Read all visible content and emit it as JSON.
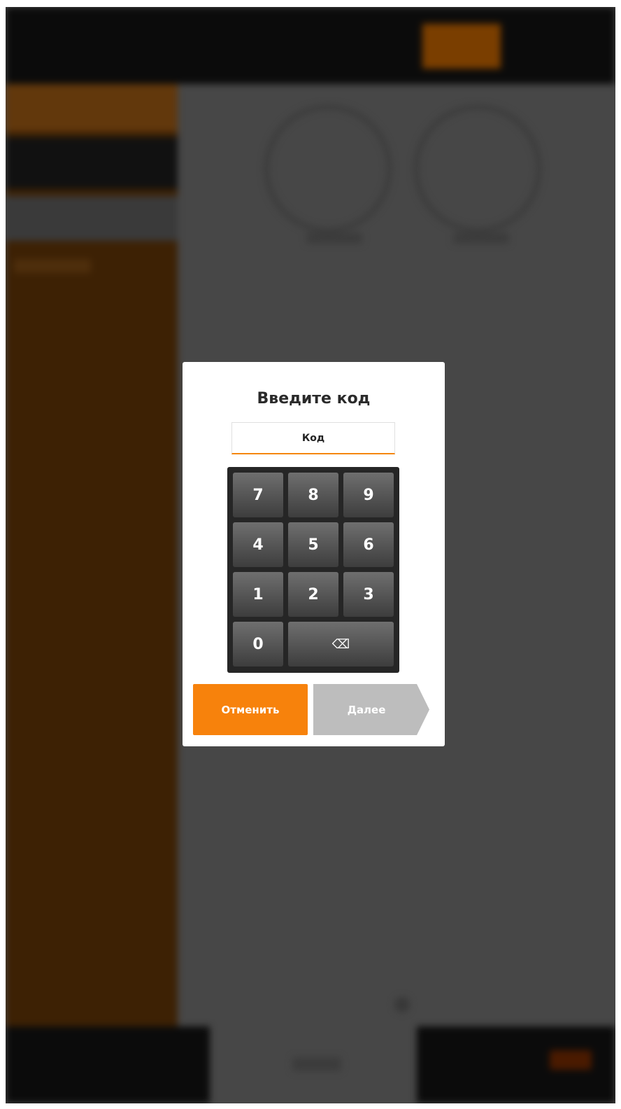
{
  "dialog": {
    "title": "Введите код",
    "input_placeholder": "Код",
    "input_value": "",
    "keys": [
      "7",
      "8",
      "9",
      "4",
      "5",
      "6",
      "1",
      "2",
      "3",
      "0"
    ],
    "backspace_icon": "backspace-icon",
    "cancel_label": "Отменить",
    "next_label": "Далее"
  },
  "colors": {
    "accent": "#f7820c",
    "disabled": "#bdbdbd",
    "keypad_bg": "#262626",
    "overlay": "#474747"
  }
}
